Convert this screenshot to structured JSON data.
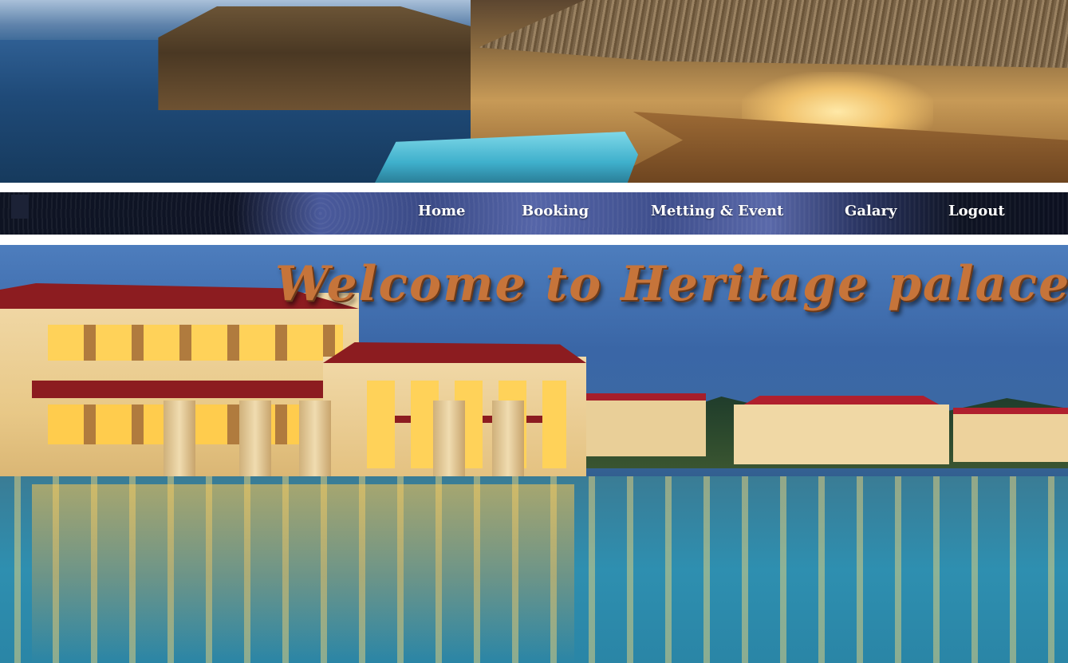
{
  "navigation": {
    "items": [
      {
        "label": "Home"
      },
      {
        "label": "Booking"
      },
      {
        "label": "Metting & Event"
      },
      {
        "label": "Galary"
      },
      {
        "label": "Logout"
      }
    ]
  },
  "hero": {
    "title": "Welcome to Heritage palace"
  },
  "colors": {
    "nav_text": "#ffffff",
    "title_text": "#c6743a",
    "roof_red": "#8c1c20"
  }
}
